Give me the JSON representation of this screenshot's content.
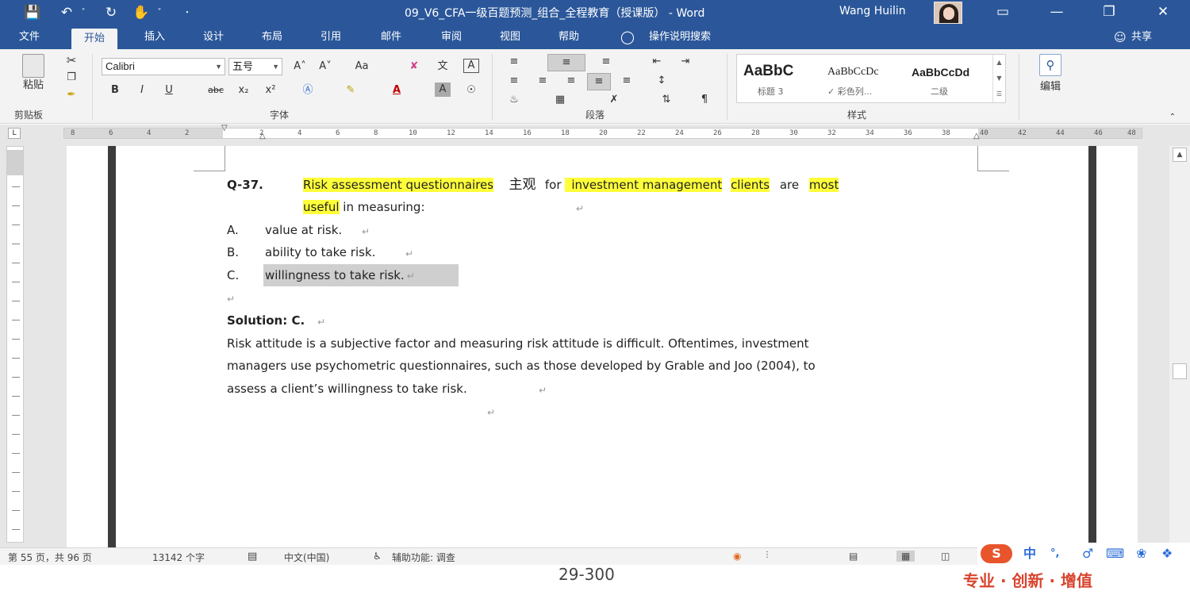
{
  "titlebar": {
    "doc_title": "09_V6_CFA一级百题预测_组合_全程教育（授课版）  -  Word",
    "user_name": "Wang Huilin",
    "quick_access": [
      "💾",
      "↶",
      "˅",
      "↻",
      "✋",
      "˅",
      "⋅"
    ],
    "window_buttons": [
      "▭",
      "—",
      "❐",
      "✕"
    ]
  },
  "ribbon_tabs": {
    "items": [
      "文件",
      "开始",
      "插入",
      "设计",
      "布局",
      "引用",
      "邮件",
      "审阅",
      "视图",
      "帮助"
    ],
    "active": "开始",
    "search_label": "操作说明搜索",
    "share_label": "共享"
  },
  "ribbon": {
    "clipboard": {
      "paste_label": "粘贴",
      "group_label": "剪贴板"
    },
    "font": {
      "font_name": "Calibri",
      "font_size": "五号",
      "group_label": "字体",
      "format_buttons": [
        "B",
        "I",
        "U",
        "abc",
        "x₂",
        "x²"
      ],
      "grow_shrink": [
        "A˄",
        "A˅",
        "Aa",
        "文",
        "A"
      ]
    },
    "paragraph": {
      "group_label": "段落"
    },
    "styles": {
      "group_label": "样式",
      "samples": [
        {
          "sample": "AaBbC",
          "name": "标题 3"
        },
        {
          "sample": "AaBbCcDc",
          "name": "✓ 彩色列..."
        },
        {
          "sample": "AaBbCcDd",
          "name": "二级"
        }
      ]
    },
    "editing": {
      "label": "编辑"
    }
  },
  "ruler": {
    "ticks": [
      "8",
      "6",
      "4",
      "2",
      "2",
      "4",
      "6",
      "8",
      "10",
      "12",
      "14",
      "16",
      "18",
      "20",
      "22",
      "24",
      "26",
      "28",
      "30",
      "32",
      "34",
      "36",
      "38",
      "40",
      "42",
      "44",
      "46",
      "48"
    ]
  },
  "document": {
    "question_number": "Q-37.",
    "question_parts": [
      {
        "text": "Risk assessment questionnaires",
        "hl": true
      },
      {
        "text": " 主观 ",
        "hl": false
      },
      {
        "text": " for ",
        "hl": false
      },
      {
        "text": "investment management",
        "hl": true
      },
      {
        "text": " ",
        "hl": false
      },
      {
        "text": "clients",
        "hl": true
      },
      {
        "text": " are ",
        "hl": false
      },
      {
        "text": "most",
        "hl": true
      }
    ],
    "question_line2_hl": "useful",
    "question_line2_rest": " in measuring:",
    "options": [
      {
        "letter": "A.",
        "text": "value at risk."
      },
      {
        "letter": "B.",
        "text": "ability to take risk."
      },
      {
        "letter": "C.",
        "text": "willingness to take risk."
      }
    ],
    "solution_label": "Solution: C.",
    "explanation_lines": [
      "Risk attitude is a subjective factor and measuring risk attitude is difficult. Oftentimes, investment",
      "managers use psychometric questionnaires, such as those developed by Grable and Joo (2004), to",
      "assess a client’s willingness to take risk."
    ],
    "pilcrow": "↵"
  },
  "statusbar": {
    "page_info": "第 55 页，共 96 页",
    "word_count": "13142 个字",
    "language": "中文(中国)",
    "accessibility": "辅助功能: 调查"
  },
  "ime": {
    "icons": [
      "S",
      "中",
      "°,",
      "♂",
      "⌨",
      "❀",
      "❖"
    ]
  },
  "footer": {
    "page_number": "29-300",
    "slogan": "专业 · 创新 · 增值"
  },
  "colors": {
    "brand": "#2b579a",
    "highlight": "#ffff3a",
    "slogan": "#d9442e"
  }
}
